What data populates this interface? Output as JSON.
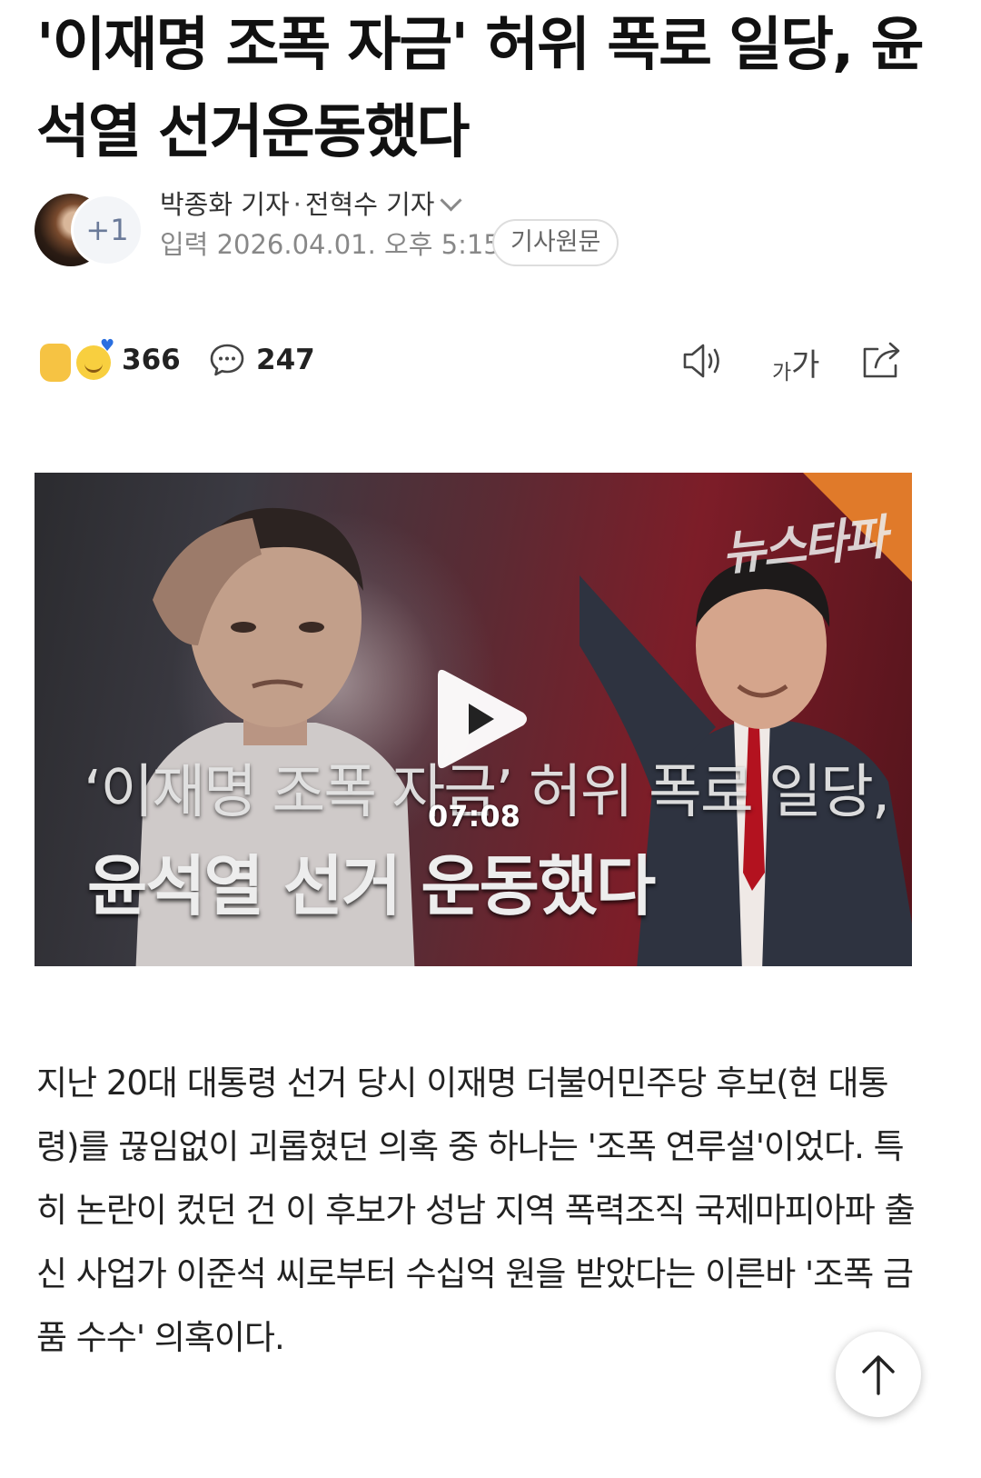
{
  "article": {
    "headline": "'이재명 조폭 자금' 허위 폭로 일당, 윤석열 선거운동했다",
    "reporter_1": "박종화 기자",
    "separator": "·",
    "reporter_2": "전혁수 기자",
    "date": "입력 2026.04.01. 오후 5:15",
    "source_button": "기사원문",
    "extra_reporters": "+1",
    "body": "지난 20대 대통령 선거 당시 이재명 더불어민주당 후보(현 대통령)를 끊임없이 괴롭혔던 의혹 중 하나는 '조폭 연루설'이었다. 특히 논란이 컸던 건 이 후보가 성남 지역 폭력조직 국제마피아파 출신 사업가 이준석 씨로부터 수십억 원을 받았다는 이른바 '조폭 금품 수수' 의혹이다."
  },
  "actions": {
    "reaction_count": "366",
    "comment_count": "247",
    "font_size_small": "가",
    "font_size_large": "가"
  },
  "video": {
    "logo_text": "뉴스타파",
    "caption_line1": "‘이재명 조폭 자금’ 허위 폭로 일당,",
    "caption_line2": "윤석열 선거 운동했다",
    "duration": "07:08"
  },
  "icons": {
    "comment": "speech-bubble",
    "speaker": "speaker",
    "share": "share-arrow",
    "scroll_top": "arrow-up",
    "play": "play-triangle"
  },
  "colors": {
    "text_primary": "#111111",
    "text_secondary": "#888888",
    "avatar_badge_text": "#6a7a99",
    "video_accent": "#e07a2a"
  }
}
